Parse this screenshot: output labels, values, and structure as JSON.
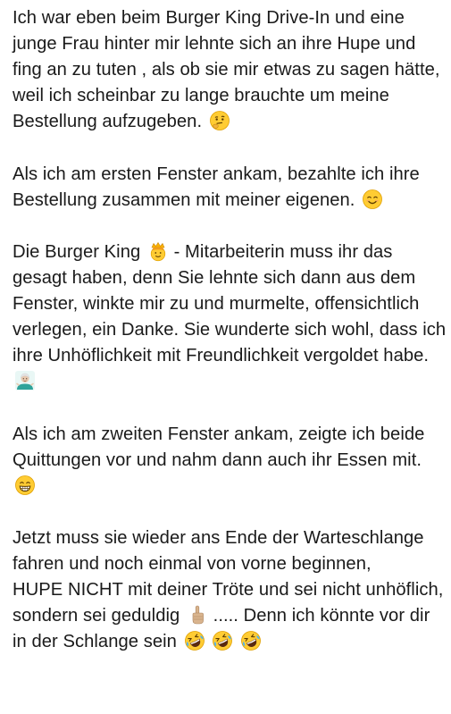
{
  "post": {
    "paragraphs": [
      {
        "text": "Ich war eben beim Burger King Drive-In und eine junge Frau hinter mir lehnte sich an ihre Hupe und fing an zu tuten , als ob sie mir etwas zu sagen hätte, weil ich scheinbar zu lange brauchte um meine Bestellung aufzugeben.",
        "emoji": "thinking-face-emoji"
      },
      {
        "text": "Als ich am ersten Fenster ankam, bezahlte ich ihre Bestellung zusammen mit meiner eigenen.",
        "emoji": "smiling-face-emoji"
      },
      {
        "text_before": "Die Burger King",
        "emoji": "crown-face-emoji",
        "text_after": "- Mitarbeiterin muss ihr das gesagt haben, denn Sie lehnte sich dann aus dem Fenster, winkte mir zu und murmelte, offensichtlich verlegen, ein Danke. Sie wunderte sich wohl, dass ich ihre Unhöflichkeit mit Freundlichkeit vergoldet habe.",
        "emoji_end": "person-shrugging-emoji"
      },
      {
        "text": "Als ich am zweiten Fenster ankam, zeigte ich beide Quittungen vor und nahm dann auch ihr Essen mit.",
        "emoji": "grinning-face-emoji"
      },
      {
        "line1": "Jetzt muss sie wieder ans Ende der Warteschlange fahren und noch einmal von vorne beginnen,",
        "line2_before": "HUPE NICHT mit deiner Tröte und sei nicht unhöflich, sondern sei geduldig",
        "line2_emoji": "index-pointing-up-emoji",
        "line2_after": "..... Denn ich könnte vor dir in der Schlange sein",
        "line2_end_emojis": [
          "rolling-laughing-emoji",
          "rolling-laughing-emoji",
          "rolling-laughing-emoji"
        ]
      }
    ]
  },
  "colors": {
    "text": "#1a1a1a",
    "background": "#ffffff",
    "emoji_yellow": "#ffcc33",
    "emoji_outline": "#e0a000",
    "skin_light": "#e8c9b0",
    "shirt_teal": "#2fa39a"
  }
}
